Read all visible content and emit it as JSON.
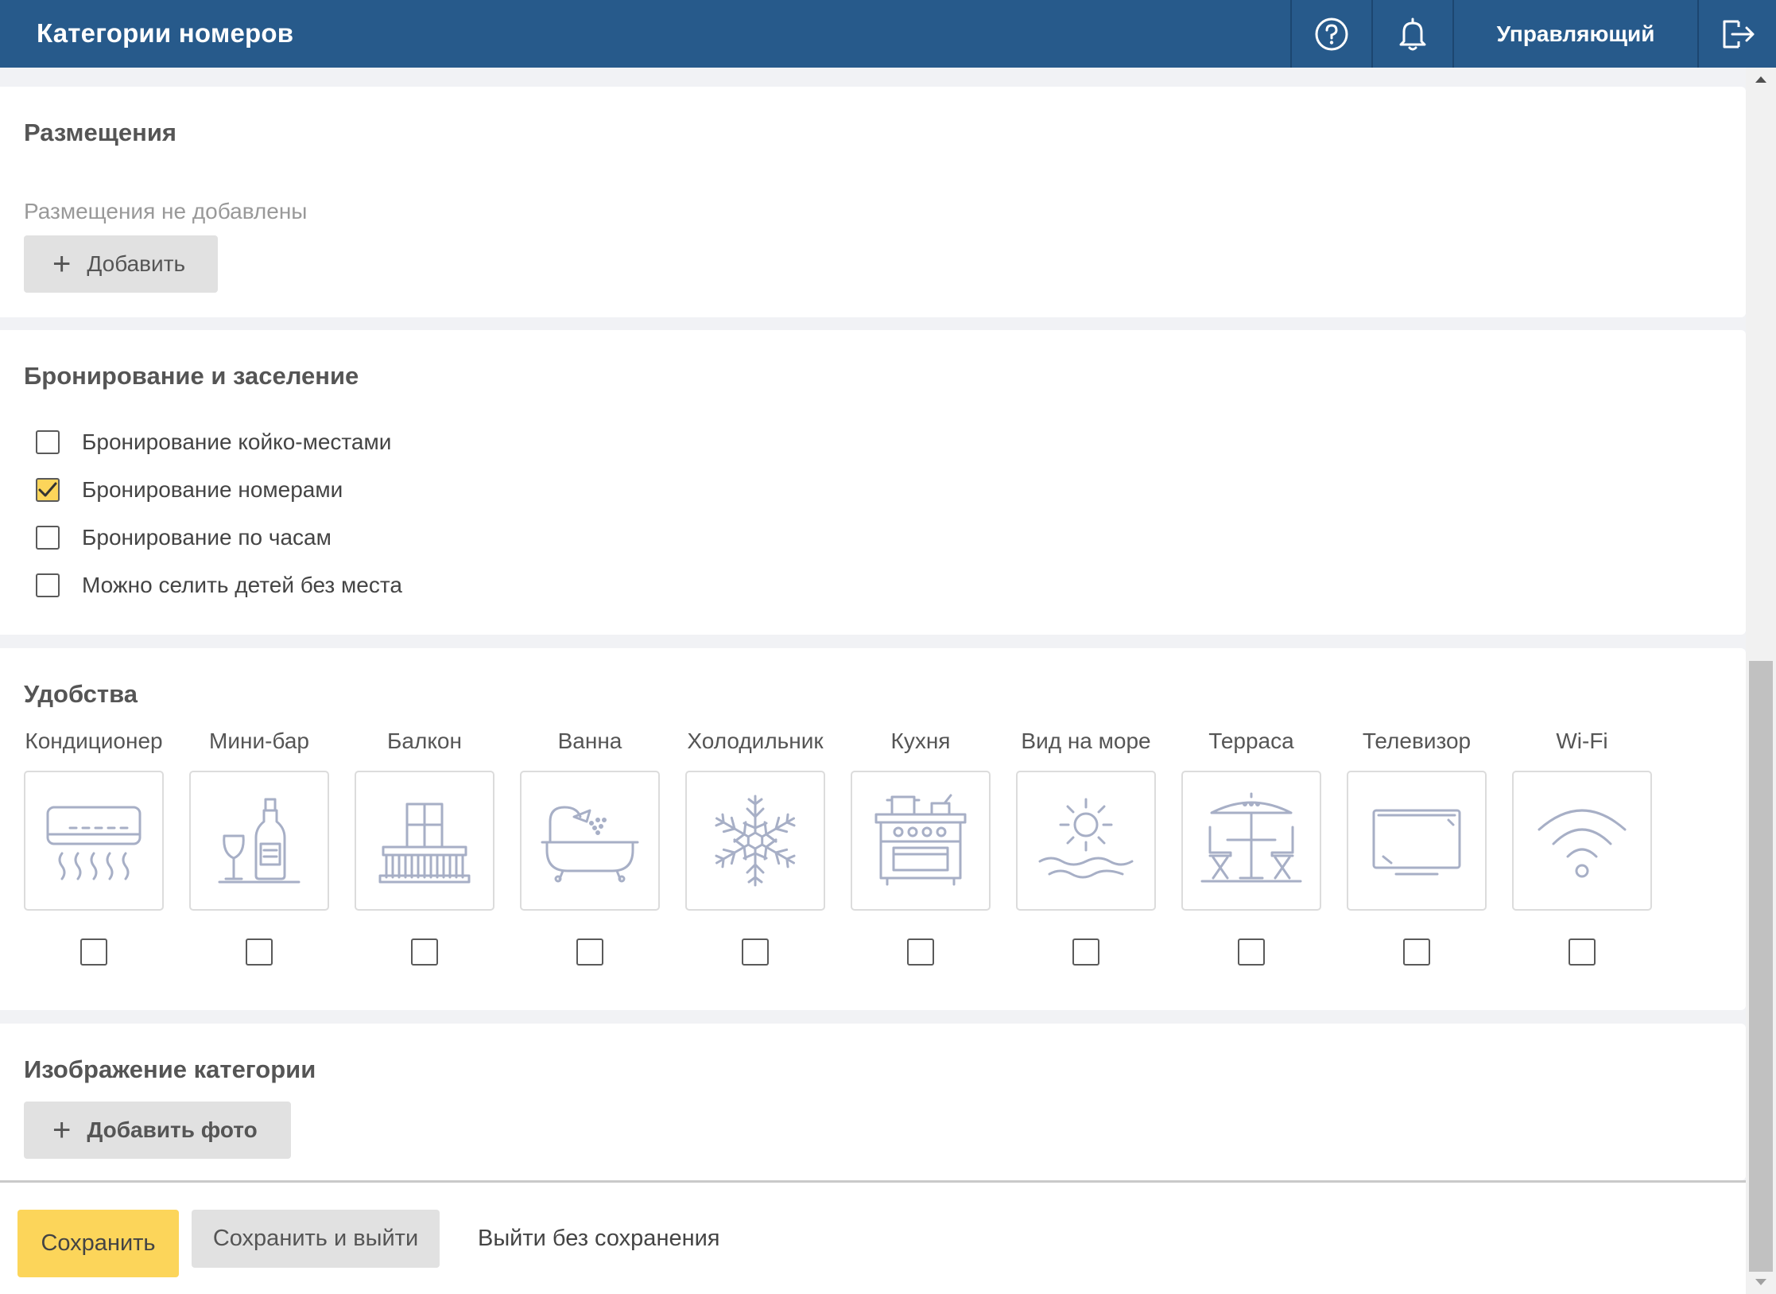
{
  "header": {
    "title": "Категории номеров",
    "help_icon": "question-circle-icon",
    "bell_icon": "bell-icon",
    "user_label": "Управляющий",
    "logout_icon": "logout-icon",
    "background_color": "#275a8b"
  },
  "placements": {
    "title": "Размещения",
    "empty_text": "Размещения не добавлены",
    "add_button_label": "Добавить"
  },
  "booking": {
    "title": "Бронирование и заселение",
    "options": [
      {
        "label": "Бронирование койко-местами",
        "checked": false
      },
      {
        "label": "Бронирование номерами",
        "checked": true
      },
      {
        "label": "Бронирование по часам",
        "checked": false
      },
      {
        "label": "Можно селить детей без места",
        "checked": false
      }
    ]
  },
  "amenities": {
    "title": "Удобства",
    "items": [
      {
        "label": "Кондиционер",
        "icon": "air-conditioner-icon",
        "checked": false
      },
      {
        "label": "Мини-бар",
        "icon": "minibar-icon",
        "checked": false
      },
      {
        "label": "Балкон",
        "icon": "balcony-icon",
        "checked": false
      },
      {
        "label": "Ванна",
        "icon": "bathtub-icon",
        "checked": false
      },
      {
        "label": "Холодильник",
        "icon": "snowflake-icon",
        "checked": false
      },
      {
        "label": "Кухня",
        "icon": "stove-icon",
        "checked": false
      },
      {
        "label": "Вид на море",
        "icon": "sea-view-icon",
        "checked": false
      },
      {
        "label": "Терраса",
        "icon": "terrace-icon",
        "checked": false
      },
      {
        "label": "Телевизор",
        "icon": "tv-icon",
        "checked": false
      },
      {
        "label": "Wi-Fi",
        "icon": "wifi-icon",
        "checked": false
      }
    ]
  },
  "category_image": {
    "title": "Изображение категории",
    "add_photo_label": "Добавить фото"
  },
  "footer": {
    "save_label": "Сохранить",
    "save_exit_label": "Сохранить и выйти",
    "exit_no_save_label": "Выйти без сохранения",
    "save_color": "#fcd55a"
  }
}
